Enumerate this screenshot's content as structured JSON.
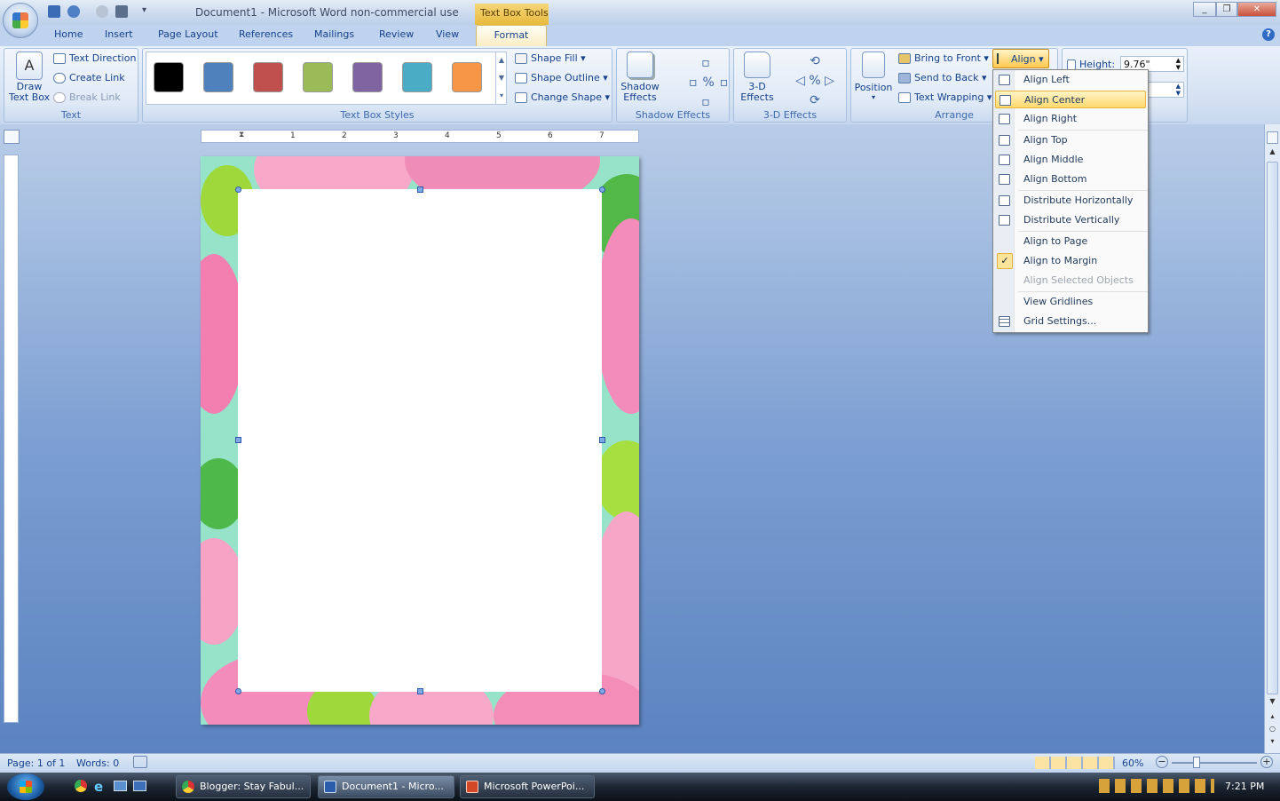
{
  "window": {
    "title": "Document1 - Microsoft Word non-commercial use",
    "context_tab_group": "Text Box Tools",
    "controls": [
      "_",
      "❐",
      "✕"
    ]
  },
  "tabs": [
    "Home",
    "Insert",
    "Page Layout",
    "References",
    "Mailings",
    "Review",
    "View",
    "Format"
  ],
  "active_tab": "Format",
  "ribbon": {
    "text_group": {
      "label": "Text",
      "draw_text_box": "Draw\nText Box",
      "text_direction": "Text Direction",
      "create_link": "Create Link",
      "break_link": "Break Link"
    },
    "styles_group": {
      "label": "Text Box Styles",
      "swatches": [
        "#000000",
        "#4f81bd",
        "#c0504d",
        "#9bbb59",
        "#8064a2",
        "#4bacc6",
        "#f79646"
      ],
      "shape_fill": "Shape Fill",
      "shape_outline": "Shape Outline",
      "change_shape": "Change Shape"
    },
    "shadow_group": {
      "label": "Shadow Effects",
      "button": "Shadow\nEffects"
    },
    "threed_group": {
      "label": "3-D Effects",
      "button": "3-D\nEffects"
    },
    "arrange_group": {
      "label": "Arrange",
      "position": "Position",
      "bring_to_front": "Bring to Front",
      "send_to_back": "Send to Back",
      "text_wrapping": "Text Wrapping",
      "align": "Align"
    },
    "size_group": {
      "height_label": "Height:",
      "height_value": "9.76\""
    }
  },
  "align_menu": {
    "items": [
      {
        "label": "Align Left",
        "state": "normal"
      },
      {
        "label": "Align Center",
        "state": "highlighted"
      },
      {
        "label": "Align Right",
        "state": "normal"
      },
      {
        "label": "Align Top",
        "state": "normal"
      },
      {
        "label": "Align Middle",
        "state": "normal"
      },
      {
        "label": "Align Bottom",
        "state": "normal"
      },
      {
        "label": "Distribute Horizontally",
        "state": "normal"
      },
      {
        "label": "Distribute Vertically",
        "state": "normal"
      },
      {
        "label": "Align to Page",
        "state": "normal"
      },
      {
        "label": "Align to Margin",
        "state": "checked"
      },
      {
        "label": "Align Selected Objects",
        "state": "disabled"
      },
      {
        "label": "View Gridlines",
        "state": "normal"
      },
      {
        "label": "Grid Settings...",
        "state": "normal"
      }
    ]
  },
  "ruler": {
    "numbers": [
      "1",
      "2",
      "3",
      "4",
      "5",
      "6",
      "7"
    ]
  },
  "status": {
    "page": "Page: 1 of 1",
    "words": "Words: 0",
    "zoom": "60%"
  },
  "taskbar": {
    "items": [
      "Blogger: Stay Fabul...",
      "Document1 - Micro...",
      "Microsoft PowerPoi..."
    ],
    "clock": "7:21 PM"
  }
}
